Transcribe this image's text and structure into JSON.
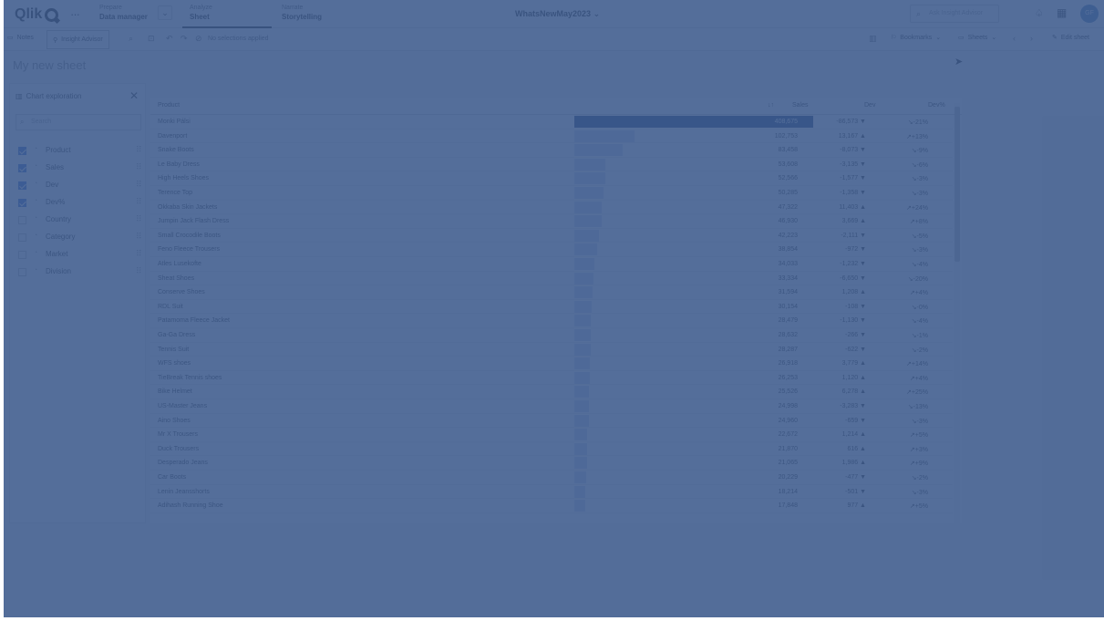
{
  "topbar": {
    "logo": "Qlik",
    "nav": [
      {
        "small": "Prepare",
        "big": "Data manager"
      },
      {
        "small": "Analyze",
        "big": "Sheet"
      },
      {
        "small": "Narrate",
        "big": "Storytelling"
      }
    ],
    "app_name": "WhatsNewMay2023",
    "search_placeholder": "Ask Insight Advisor",
    "avatar_initials": "GF"
  },
  "toolbar": {
    "notes": "Notes",
    "insight_advisor": "Insight Advisor",
    "no_selections": "No selections applied",
    "bookmarks": "Bookmarks",
    "sheets": "Sheets",
    "edit_sheet": "Edit sheet"
  },
  "sheet": {
    "title": "My new sheet"
  },
  "panel": {
    "title": "Chart exploration",
    "search_placeholder": "Search",
    "fields": [
      {
        "name": "Product",
        "checked": true
      },
      {
        "name": "Sales",
        "checked": true
      },
      {
        "name": "Dev",
        "checked": true
      },
      {
        "name": "Dev%",
        "checked": true
      },
      {
        "name": "Country",
        "checked": false
      },
      {
        "name": "Category",
        "checked": false
      },
      {
        "name": "Market",
        "checked": false
      },
      {
        "name": "Division",
        "checked": false
      }
    ]
  },
  "table": {
    "columns": [
      "Product",
      "Sales",
      "Dev",
      "Dev%"
    ],
    "sort_indicator": "↓↑",
    "rows": [
      {
        "product": "Monki Pálsi",
        "sales": "408,675",
        "dev": "-86,573 ▼",
        "devp": "↘-21%",
        "ratio": 1.0
      },
      {
        "product": "Davenport",
        "sales": "102,753",
        "dev": "13,167 ▲",
        "devp": "↗+13%",
        "ratio": 0.251
      },
      {
        "product": "Snake Boots",
        "sales": "83,458",
        "dev": "-8,073 ▼",
        "devp": "↘-9%",
        "ratio": 0.204
      },
      {
        "product": "Le Baby Dress",
        "sales": "53,608",
        "dev": "-3,135 ▼",
        "devp": "↘-6%",
        "ratio": 0.131
      },
      {
        "product": "High Heels Shoes",
        "sales": "52,566",
        "dev": "-1,577 ▼",
        "devp": "↘-3%",
        "ratio": 0.129
      },
      {
        "product": "Terence Top",
        "sales": "50,285",
        "dev": "-1,358 ▼",
        "devp": "↘-3%",
        "ratio": 0.123
      },
      {
        "product": "Okkaba Skin Jackets",
        "sales": "47,322",
        "dev": "11,403 ▲",
        "devp": "↗+24%",
        "ratio": 0.116
      },
      {
        "product": "Jumpin Jack Flash Dress",
        "sales": "46,930",
        "dev": "3,669 ▲",
        "devp": "↗+8%",
        "ratio": 0.115
      },
      {
        "product": "Small Crocodile Boots",
        "sales": "42,223",
        "dev": "-2,111 ▼",
        "devp": "↘-5%",
        "ratio": 0.103
      },
      {
        "product": "Feno Fleece Trousers",
        "sales": "38,854",
        "dev": "-972 ▼",
        "devp": "↘-3%",
        "ratio": 0.095
      },
      {
        "product": "Atles Lusekofte",
        "sales": "34,033",
        "dev": "-1,232 ▼",
        "devp": "↘-4%",
        "ratio": 0.083
      },
      {
        "product": "Sheat Shoes",
        "sales": "33,334",
        "dev": "-6,650 ▼",
        "devp": "↘-20%",
        "ratio": 0.082
      },
      {
        "product": "Conserve Shoes",
        "sales": "31,594",
        "dev": "1,208 ▲",
        "devp": "↗+4%",
        "ratio": 0.077
      },
      {
        "product": "RDL Suit",
        "sales": "30,154",
        "dev": "-108 ▼",
        "devp": "↘-0%",
        "ratio": 0.074
      },
      {
        "product": "Patamoma Fleece Jacket",
        "sales": "28,479",
        "dev": "-1,130 ▼",
        "devp": "↘-4%",
        "ratio": 0.07
      },
      {
        "product": "Ga-Ga Dress",
        "sales": "28,632",
        "dev": "-266 ▼",
        "devp": "↘-1%",
        "ratio": 0.07
      },
      {
        "product": "Tennis Suit",
        "sales": "28,287",
        "dev": "-622 ▼",
        "devp": "↘-2%",
        "ratio": 0.069
      },
      {
        "product": "WFS shoes",
        "sales": "26,918",
        "dev": "3,779 ▲",
        "devp": "↗+14%",
        "ratio": 0.066
      },
      {
        "product": "TieBreak Tennis shoes",
        "sales": "26,253",
        "dev": "1,120 ▲",
        "devp": "↗+4%",
        "ratio": 0.064
      },
      {
        "product": "Bike Helmet",
        "sales": "25,526",
        "dev": "6,278 ▲",
        "devp": "↗+25%",
        "ratio": 0.062
      },
      {
        "product": "US-Master Jeans",
        "sales": "24,998",
        "dev": "-3,283 ▼",
        "devp": "↘-13%",
        "ratio": 0.061
      },
      {
        "product": "Aino Shoes",
        "sales": "24,960",
        "dev": "-659 ▼",
        "devp": "↘-3%",
        "ratio": 0.061
      },
      {
        "product": "Mr X Trousers",
        "sales": "22,672",
        "dev": "1,214 ▲",
        "devp": "↗+5%",
        "ratio": 0.055
      },
      {
        "product": "Duck Trousers",
        "sales": "21,870",
        "dev": "616 ▲",
        "devp": "↗+3%",
        "ratio": 0.054
      },
      {
        "product": "Desperado Jeans",
        "sales": "21,065",
        "dev": "1,986 ▲",
        "devp": "↗+9%",
        "ratio": 0.052
      },
      {
        "product": "Car Boots",
        "sales": "20,229",
        "dev": "-477 ▼",
        "devp": "↘-2%",
        "ratio": 0.049
      },
      {
        "product": "Lenin Jeansshorts",
        "sales": "18,214",
        "dev": "-501 ▼",
        "devp": "↘-3%",
        "ratio": 0.045
      },
      {
        "product": "Adihash Running Shoe",
        "sales": "17,848",
        "dev": "977 ▲",
        "devp": "↗+5%",
        "ratio": 0.044
      }
    ]
  },
  "colors": {
    "overlay": "#3c5a8c",
    "accent": "#3a6ec9",
    "bar": "#c9d6ea",
    "top_bar": "#1f3f73"
  }
}
